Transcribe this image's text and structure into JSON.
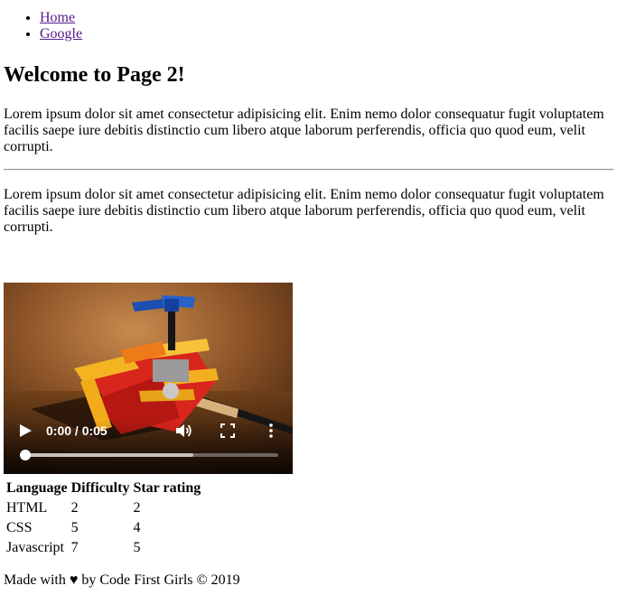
{
  "nav": {
    "items": [
      {
        "label": "Home"
      },
      {
        "label": "Google"
      }
    ]
  },
  "title": "Welcome to Page 2!",
  "paragraphs": [
    "Lorem ipsum dolor sit amet consectetur adipisicing elit. Enim nemo dolor consequatur fugit voluptatem facilis saepe iure debitis distinctio cum libero atque laborum perferendis, officia quo quod eum, velit corrupti.",
    "Lorem ipsum dolor sit amet consectetur adipisicing elit. Enim nemo dolor consequatur fugit voluptatem facilis saepe iure debitis distinctio cum libero atque laborum perferendis, officia quo quod eum, velit corrupti."
  ],
  "video": {
    "time": "0:00 / 0:05",
    "progress": 0,
    "buffered": 0.67,
    "icons": {
      "play": "play-icon",
      "volume": "volume-icon",
      "fullscreen": "fullscreen-icon",
      "menu": "more-vert-icon"
    }
  },
  "table": {
    "headers": [
      "Language",
      "Difficulty",
      "Star rating"
    ],
    "rows": [
      [
        "HTML",
        "2",
        "2"
      ],
      [
        "CSS",
        "5",
        "4"
      ],
      [
        "Javascript",
        "7",
        "5"
      ]
    ]
  },
  "footer": {
    "text": "Made with ♥ by Code First Girls © 2019"
  },
  "colors": {
    "link": "#551a8b",
    "text": "#000000"
  }
}
